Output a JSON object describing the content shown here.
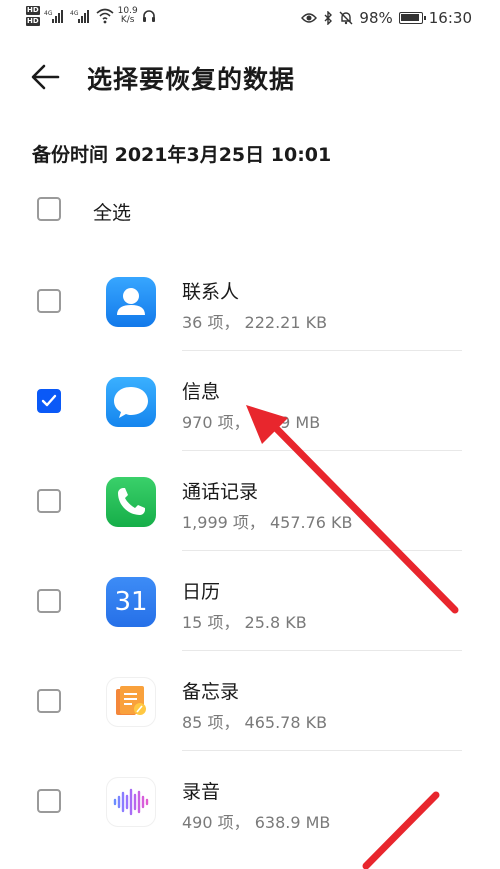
{
  "status_bar": {
    "hd1": "HD",
    "hd2": "HD",
    "net_speed_value": "10.9",
    "net_speed_unit": "K/s",
    "battery": "98%",
    "time": "16:30"
  },
  "header": {
    "title": "选择要恢复的数据"
  },
  "backup_time": "备份时间 2021年3月25日 10:01",
  "select_all": {
    "label": "全选",
    "checked": false
  },
  "items": [
    {
      "title": "联系人",
      "subtitle": "36 项， 222.21 KB",
      "checked": false,
      "icon": "contacts-icon"
    },
    {
      "title": "信息",
      "subtitle": "970 项， 3.09 MB",
      "checked": true,
      "icon": "messages-icon"
    },
    {
      "title": "通话记录",
      "subtitle": "1,999 项， 457.76 KB",
      "checked": false,
      "icon": "phone-icon"
    },
    {
      "title": "日历",
      "subtitle": "15 项， 25.8 KB",
      "checked": false,
      "icon": "calendar-icon",
      "icon_text": "31"
    },
    {
      "title": "备忘录",
      "subtitle": "85 项， 465.78 KB",
      "checked": false,
      "icon": "notes-icon"
    },
    {
      "title": "录音",
      "subtitle": "490 项， 638.9 MB",
      "checked": false,
      "icon": "recorder-icon"
    }
  ],
  "colors": {
    "accent": "#0a59f7",
    "annotation_arrow": "#e8262d"
  }
}
